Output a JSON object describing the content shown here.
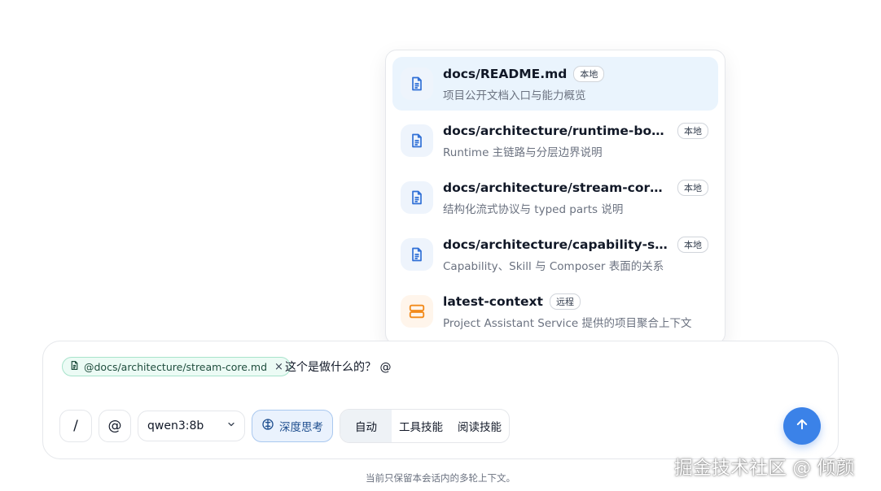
{
  "mention_menu": {
    "items": [
      {
        "title": "docs/README.md",
        "badge": "本地",
        "desc": "项目公开文档入口与能力概览",
        "icon": "document-icon"
      },
      {
        "title": "docs/architecture/runtime-boun…",
        "badge": "本地",
        "desc": "Runtime 主链路与分层边界说明",
        "icon": "document-icon"
      },
      {
        "title": "docs/architecture/stream-core.md",
        "badge": "本地",
        "desc": "结构化流式协议与 typed parts 说明",
        "icon": "document-icon"
      },
      {
        "title": "docs/architecture/capability-skill…",
        "badge": "本地",
        "desc": "Capability、Skill 与 Composer 表面的关系",
        "icon": "document-icon"
      },
      {
        "title": "latest-context",
        "badge": "远程",
        "desc": "Project Assistant Service 提供的项目聚合上下文",
        "icon": "server-icon"
      }
    ]
  },
  "composer": {
    "mention_chip": "@docs/architecture/stream-core.md",
    "chip_close": "×",
    "input_text": "这个是做什么的？ @",
    "slash_label": "/",
    "at_label": "@",
    "model": "qwen3:8b",
    "think_label": "深度思考",
    "modes": [
      "自动",
      "工具技能",
      "阅读技能"
    ],
    "active_mode": "自动"
  },
  "footer_note": "当前只保留本会话内的多轮上下文。",
  "watermark": "掘金技术社区 @ 倾颜",
  "colors": {
    "accent": "#3b82e8",
    "chip_bg": "#ecfbf5",
    "active_item_bg": "#eaf4fd",
    "remote_icon": "#f28a1a"
  }
}
